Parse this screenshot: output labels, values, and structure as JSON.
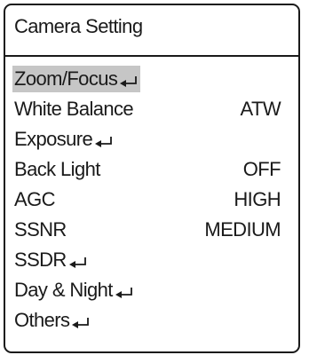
{
  "menu": {
    "title": "Camera Setting",
    "items": [
      {
        "label": "Zoom/Focus",
        "value": "",
        "submenu": true,
        "selected": true
      },
      {
        "label": "White Balance",
        "value": "ATW",
        "submenu": false,
        "selected": false
      },
      {
        "label": "Exposure",
        "value": "",
        "submenu": true,
        "selected": false
      },
      {
        "label": "Back Light",
        "value": "OFF",
        "submenu": false,
        "selected": false
      },
      {
        "label": "AGC",
        "value": "HIGH",
        "submenu": false,
        "selected": false
      },
      {
        "label": "SSNR",
        "value": "MEDIUM",
        "submenu": false,
        "selected": false
      },
      {
        "label": "SSDR",
        "value": "",
        "submenu": true,
        "selected": false
      },
      {
        "label": "Day & Night",
        "value": "",
        "submenu": true,
        "selected": false
      },
      {
        "label": "Others",
        "value": "",
        "submenu": true,
        "selected": false
      }
    ]
  },
  "colors": {
    "border": "#1a1a1a",
    "text": "#1a1a1a",
    "selection": "#c6c6c6",
    "background": "#ffffff"
  },
  "icons": {
    "submenu": "enter-return-icon"
  }
}
